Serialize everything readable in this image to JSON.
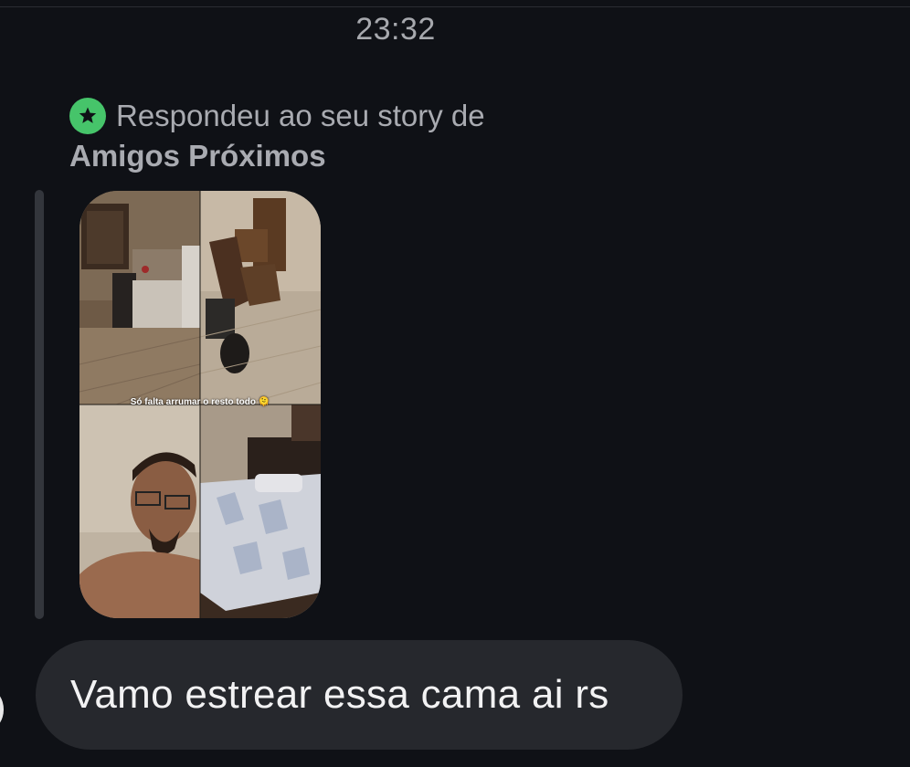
{
  "chat": {
    "timestamp": "23:32",
    "reply_context": {
      "line1": "Respondeu ao seu story de",
      "line2": "Amigos Próximos",
      "badge_icon": "star-icon",
      "badge_color": "#46c46a"
    },
    "story": {
      "caption": "Só falta arrumar o resto todo 🫠"
    },
    "message": {
      "text": "Vamo estrear essa cama ai rs"
    }
  },
  "colors": {
    "background": "#0f1116",
    "bubble": "#26282d",
    "muted_text": "#a9abb1",
    "message_text": "#f2f2f3"
  }
}
